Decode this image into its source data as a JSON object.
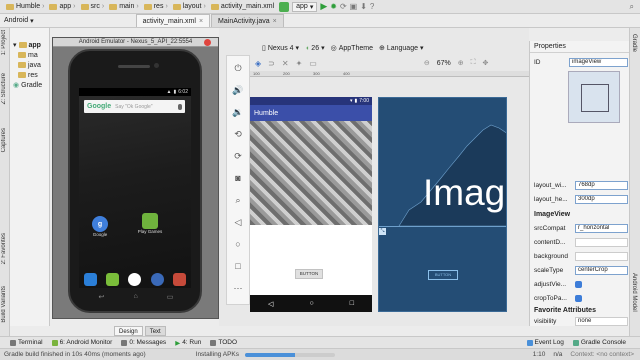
{
  "breadcrumbs": [
    {
      "label": "Humble"
    },
    {
      "label": "app"
    },
    {
      "label": "src"
    },
    {
      "label": "main"
    },
    {
      "label": "res"
    },
    {
      "label": "layout"
    },
    {
      "label": "activity_main.xml"
    }
  ],
  "run_config": "app",
  "file_tabs": [
    {
      "label": "activity_main.xml",
      "active": true
    },
    {
      "label": "MainActivity.java",
      "active": false
    }
  ],
  "project_panel": {
    "view_selector": "Android",
    "rows": [
      "app",
      "ma",
      "java",
      "res",
      "Gradle"
    ]
  },
  "left_strip_labels": [
    "1: Project",
    "Z: Structure",
    "Captures",
    "2: Favorites",
    "Build Variants"
  ],
  "right_strip_labels": [
    "Gradle",
    "Android Model"
  ],
  "emulator": {
    "title": "Android Emulator - Nexus_5_API_22:5554",
    "time": "6:02",
    "search_logo": "Google",
    "search_hint": "Say \"Ok Google\"",
    "apps": [
      {
        "label": "Google",
        "color": "#3f7fdc"
      },
      {
        "label": "Play Games",
        "color": "#6fb33d"
      }
    ],
    "dock_colors": [
      "#2b7fd8",
      "#7abd3a",
      "#ffffff",
      "#3a69b8",
      "#c64a3a"
    ]
  },
  "design_toolbar": {
    "device": "Nexus 4",
    "api": "26",
    "theme": "AppTheme",
    "language": "Language",
    "zoom": "67%"
  },
  "ruler_ticks": [
    "100",
    "200",
    "300",
    "400"
  ],
  "preview": {
    "time": "7:00",
    "app_title": "Humble",
    "button_text": "BUTTON"
  },
  "blueprint": {
    "image_text": "Image",
    "button_text": "BUTTON",
    "corner": "⤡"
  },
  "properties": {
    "header": "Properties",
    "id_label": "ID",
    "id_value": "imageView",
    "layout_width_label": "layout_wi...",
    "layout_width_value": "768dp",
    "layout_height_label": "layout_he...",
    "layout_height_value": "300dp",
    "section_imageview": "ImageView",
    "src_label": "srcCompat",
    "src_value": "r_horizontal",
    "content_label": "contentD...",
    "background_label": "background",
    "scaletype_label": "scaleType",
    "scaletype_value": "centerCrop",
    "adjust_label": "adjustVie...",
    "crop_label": "cropToPa...",
    "section_favorites": "Favorite Attributes",
    "visibility_label": "visibility",
    "visibility_value": "none"
  },
  "editor_tabs": [
    "Design",
    "Text"
  ],
  "bottom_tools": [
    "Terminal",
    "6: Android Monitor",
    "0: Messages",
    "4: Run",
    "TODO"
  ],
  "bottom_right_tools": [
    "Event Log",
    "Gradle Console"
  ],
  "status": {
    "message": "Gradle build finished in 10s 40ms (moments ago)",
    "task": "Installing APKs",
    "progress": 0.55,
    "position": "1:10",
    "separator": "n/a",
    "context": "Context: <no context>"
  }
}
